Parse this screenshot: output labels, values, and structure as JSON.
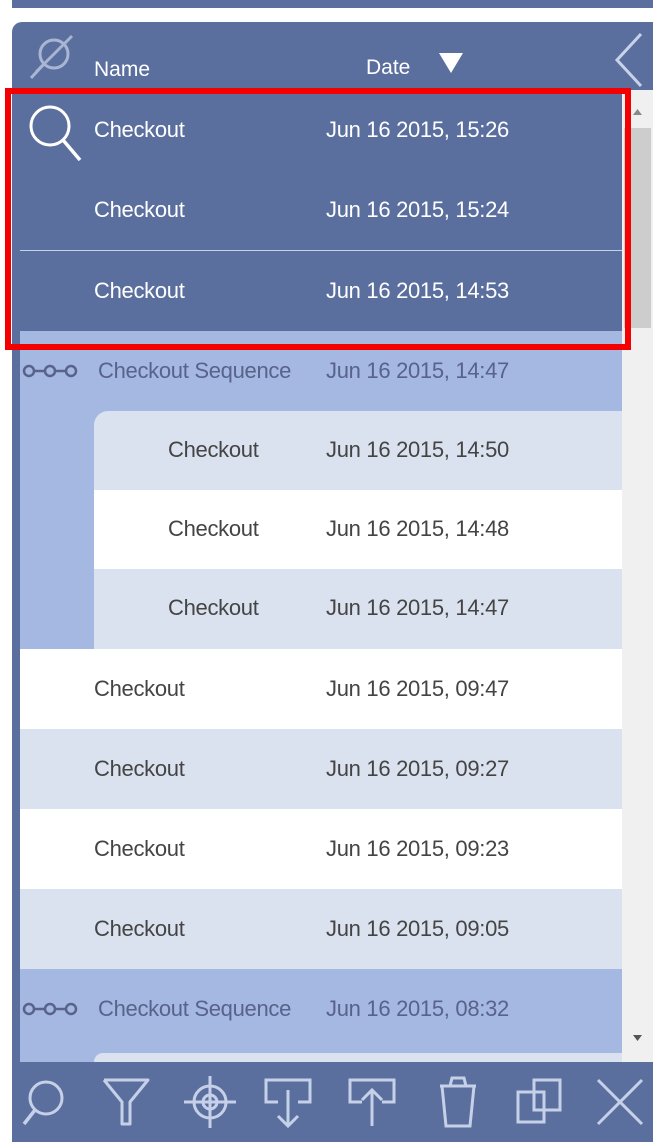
{
  "header": {
    "name_label": "Name",
    "date_label": "Date",
    "icons": [
      "no-search-icon",
      "sort-down-arrow-icon",
      "collapse-chevron-icon"
    ]
  },
  "rows": [
    {
      "name": "Checkout",
      "date": "Jun 16 2015, 15:26",
      "selected": true,
      "icon": "search-icon"
    },
    {
      "name": "Checkout",
      "date": "Jun 16 2015, 15:24",
      "selected": true
    },
    {
      "name": "Checkout",
      "date": "Jun 16 2015, 14:53",
      "selected": true
    },
    {
      "name": "Checkout Sequence",
      "date": "Jun 16 2015, 14:47",
      "group": true,
      "icon": "sequence-chain-icon",
      "children": [
        {
          "name": "Checkout",
          "date": "Jun 16 2015, 14:50"
        },
        {
          "name": "Checkout",
          "date": "Jun 16 2015, 14:48"
        },
        {
          "name": "Checkout",
          "date": "Jun 16 2015, 14:47"
        }
      ]
    },
    {
      "name": "Checkout",
      "date": "Jun 16 2015, 09:47"
    },
    {
      "name": "Checkout",
      "date": "Jun 16 2015, 09:27"
    },
    {
      "name": "Checkout",
      "date": "Jun 16 2015, 09:23"
    },
    {
      "name": "Checkout",
      "date": "Jun 16 2015, 09:05"
    },
    {
      "name": "Checkout Sequence",
      "date": "Jun 16 2015, 08:32",
      "group": true,
      "icon": "sequence-chain-icon"
    }
  ],
  "toolbar": {
    "tools": [
      "search-icon",
      "filter-icon",
      "target-icon",
      "import-icon",
      "export-icon",
      "trash-icon",
      "duplicate-icon",
      "close-icon"
    ]
  },
  "colors": {
    "panel": "#5b6f9e",
    "group_row": "#a4b8e1",
    "alt_row": "#dbe2ef",
    "highlight": "#f40000"
  }
}
